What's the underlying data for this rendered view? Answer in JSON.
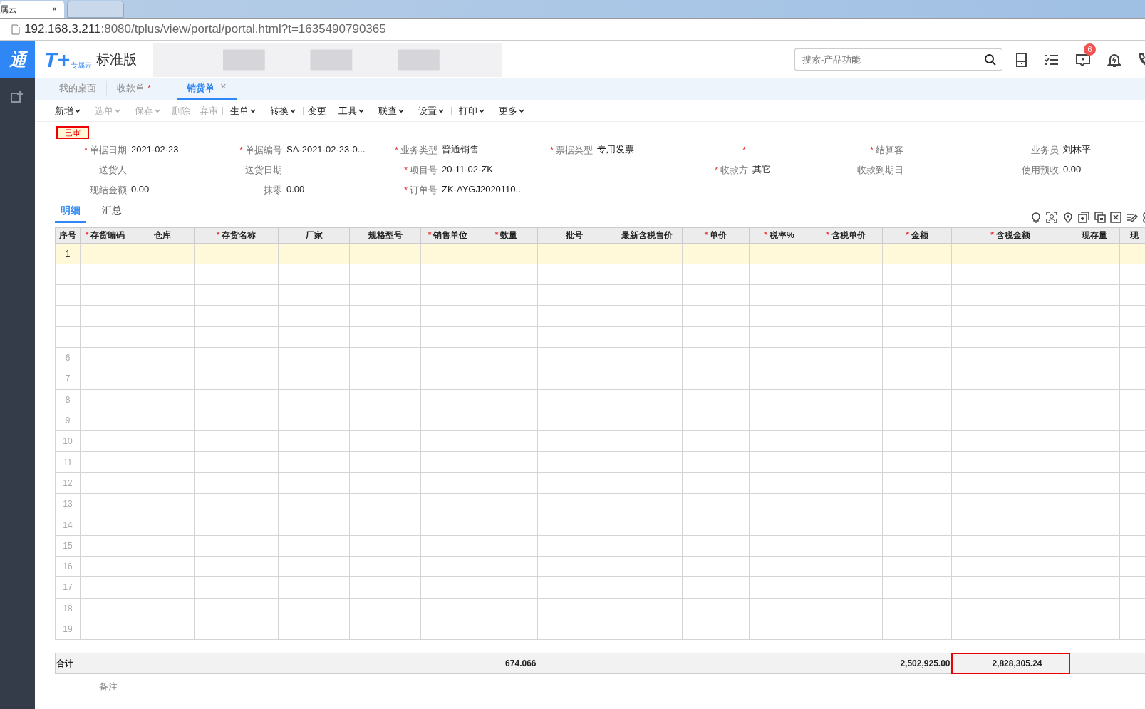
{
  "browser": {
    "tabs": [
      {
        "title": "属云",
        "close": "×",
        "selected": true
      },
      {
        "selected": false
      }
    ],
    "address": {
      "host": "192.168.3.211",
      "path": ":8080/tplus/view/portal/portal.html?t=1635490790365"
    }
  },
  "sidebar": {
    "logo": "通"
  },
  "app_header": {
    "logo_mark": "T+",
    "logo_sub": "专属云",
    "edition": "标准版",
    "search": {
      "placeholder": "搜索-产品功能"
    },
    "message_badge": "6"
  },
  "doc_tabs": [
    {
      "label": "我的桌面",
      "selected": false
    },
    {
      "label": "收款单",
      "modified_mark": "*",
      "selected": false
    },
    {
      "label": "销货单",
      "close": "×",
      "selected": true
    }
  ],
  "toolbar": [
    {
      "label": "新增",
      "dropdown": true,
      "disabled": false,
      "separator_after": false
    },
    {
      "label": "选单",
      "dropdown": true,
      "disabled": true,
      "separator_after": false
    },
    {
      "label": "保存",
      "dropdown": true,
      "disabled": true,
      "separator_after": false
    },
    {
      "label": "删除",
      "dropdown": false,
      "disabled": true,
      "separator_after": true
    },
    {
      "label": "弃审",
      "dropdown": false,
      "disabled": true,
      "separator_after": true
    },
    {
      "label": "生单",
      "dropdown": true,
      "disabled": false,
      "separator_after": false
    },
    {
      "label": "转换",
      "dropdown": true,
      "disabled": false,
      "separator_after": true
    },
    {
      "label": "变更",
      "dropdown": false,
      "disabled": false,
      "separator_after": true
    },
    {
      "label": "工具",
      "dropdown": true,
      "disabled": false,
      "separator_after": false
    },
    {
      "label": "联查",
      "dropdown": true,
      "disabled": false,
      "separator_after": false
    },
    {
      "label": "设置",
      "dropdown": true,
      "disabled": false,
      "separator_after": true
    },
    {
      "label": "打印",
      "dropdown": true,
      "disabled": false,
      "separator_after": false
    },
    {
      "label": "更多",
      "dropdown": true,
      "disabled": false,
      "separator_after": false
    }
  ],
  "status_stamp": "已审",
  "form_rows": [
    [
      {
        "label": "单据日期",
        "required_mark": "*",
        "value": "2021-02-23"
      },
      {
        "label": "单据编号",
        "required_mark": "*",
        "value": "SA-2021-02-23-0..."
      },
      {
        "label": "业务类型",
        "required_mark": "*",
        "value": "普通销售"
      },
      {
        "label": "票据类型",
        "required_mark": "*",
        "value": "专用发票"
      },
      {
        "required_mark": "*"
      },
      {
        "label": "结算客",
        "required_mark": "*"
      },
      {
        "label": "业务员",
        "value": "刘林平"
      }
    ],
    [
      {
        "label": "送货人"
      },
      {
        "label": "送货日期"
      },
      {
        "label": "项目号",
        "required_mark": "*",
        "value": "20-11-02-ZK"
      },
      {},
      {
        "label": "收款方",
        "required_mark": "*",
        "value": "其它"
      },
      {
        "label": "收款到期日"
      },
      {
        "label": "使用预收",
        "value": "0.00"
      }
    ],
    [
      {
        "label": "现结金额",
        "value": "0.00"
      },
      {
        "label": "抹零",
        "value": "0.00"
      },
      {
        "label": "订单号",
        "required_mark": "*",
        "value": "ZK-AYGJ2020110..."
      }
    ]
  ],
  "sub_tabs": [
    {
      "label": "明细",
      "selected": true
    },
    {
      "label": "汇总",
      "selected": false
    }
  ],
  "table": {
    "columns": [
      {
        "label": "序号"
      },
      {
        "label": "存货编码",
        "required_mark": "*"
      },
      {
        "label": "仓库"
      },
      {
        "label": "存货名称",
        "required_mark": "*"
      },
      {
        "label": "厂家"
      },
      {
        "label": "规格型号"
      },
      {
        "label": "销售单位",
        "required_mark": "*"
      },
      {
        "label": "数量",
        "required_mark": "*",
        "total": "674.066"
      },
      {
        "label": "批号"
      },
      {
        "label": "最新含税售价"
      },
      {
        "label": "单价",
        "required_mark": "*"
      },
      {
        "label": "税率%",
        "required_mark": "*"
      },
      {
        "label": "含税单价",
        "required_mark": "*"
      },
      {
        "label": "金额",
        "required_mark": "*",
        "total": "2,502,925.00"
      },
      {
        "label": "含税金额",
        "required_mark": "*",
        "total": "2,828,305.24",
        "highlighted": true
      },
      {
        "label": "现存量"
      },
      {
        "label": "现"
      }
    ],
    "rows": [
      {
        "number": "1",
        "selected": true
      },
      {
        "selected": false
      },
      {
        "selected": false
      },
      {
        "selected": false
      },
      {
        "selected": false
      },
      {
        "number": "6",
        "selected": false
      },
      {
        "number": "7",
        "selected": false
      },
      {
        "number": "8",
        "selected": false
      },
      {
        "number": "9",
        "selected": false
      },
      {
        "number": "10",
        "selected": false
      },
      {
        "number": "11",
        "selected": false
      },
      {
        "number": "12",
        "selected": false
      },
      {
        "number": "13",
        "selected": false
      },
      {
        "number": "14",
        "selected": false
      },
      {
        "number": "15",
        "selected": false
      },
      {
        "number": "16",
        "selected": false
      },
      {
        "number": "17",
        "selected": false
      },
      {
        "number": "18",
        "selected": false
      },
      {
        "number": "19",
        "selected": false
      }
    ],
    "total_label": "合计"
  },
  "notes_label": "备注"
}
